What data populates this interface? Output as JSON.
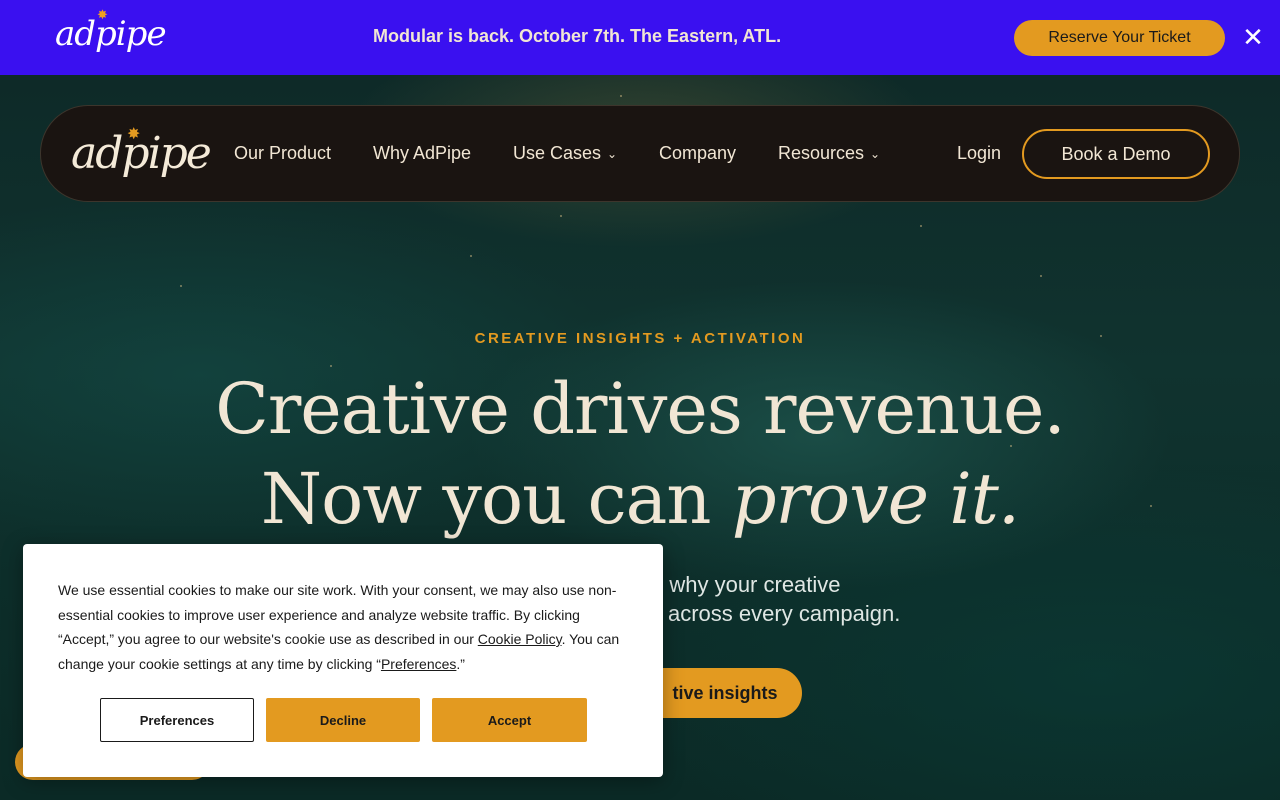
{
  "banner": {
    "logo": "adpipe",
    "text": "Modular is back. October 7th. The Eastern, ATL.",
    "cta": "Reserve Your Ticket",
    "close_icon": "close-icon"
  },
  "nav": {
    "logo": "adpipe",
    "items": [
      {
        "label": "Our Product",
        "dropdown": false
      },
      {
        "label": "Why AdPipe",
        "dropdown": false
      },
      {
        "label": "Use Cases",
        "dropdown": true
      },
      {
        "label": "Company",
        "dropdown": false
      },
      {
        "label": "Resources",
        "dropdown": true
      }
    ],
    "login": "Login",
    "demo": "Book a Demo"
  },
  "hero": {
    "eyebrow": "CREATIVE INSIGHTS + ACTIVATION",
    "line1": "Creative drives revenue.",
    "line2_plain": "Now you can ",
    "line2_italic": "prove it.",
    "sub_line1": "ce why your creative",
    "sub_line2": "across every campaign.",
    "cta": "tive insights"
  },
  "cookie": {
    "text_part1": "We use essential cookies to make our site work. With your consent, we may also use non-essential cookies to improve user experience and analyze website traffic. By clicking “Accept,” you agree to our website's cookie use as described in our ",
    "policy_link": "Cookie Policy",
    "text_part2": ". You can change your cookie settings at any time by clicking “",
    "preferences_link": "Preferences",
    "text_part3": ".”",
    "buttons": {
      "preferences": "Preferences",
      "decline": "Decline",
      "accept": "Accept"
    }
  },
  "colors": {
    "banner_bg": "#3a10f0",
    "accent": "#e39a20",
    "nav_bg": "#1a1411",
    "text_cream": "#f1e6d4"
  }
}
